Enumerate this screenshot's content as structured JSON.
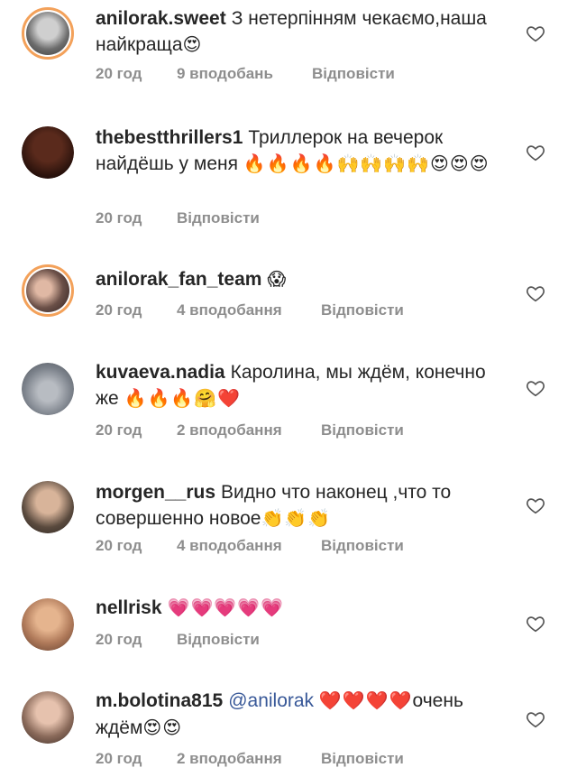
{
  "comments": [
    {
      "username": "anilorak.sweet",
      "text": "З нетерпінням чекаємо,наша найкраща",
      "emoji": "😍",
      "time": "20 год",
      "likes": "9 вподобань",
      "reply": "Відповісти",
      "avatar_color": "#7a7a7a",
      "ring": true
    },
    {
      "username": "thebestthrillers1",
      "text": "Триллерок на вечерок найдёшь у меня",
      "emoji": "🔥🔥🔥🔥🙌🙌🙌🙌😍😍😍",
      "time": "20 год",
      "likes": "",
      "reply": "Відповісти",
      "avatar_color": "#2b1a14",
      "ring": false
    },
    {
      "username": "anilorak_fan_team",
      "text": "",
      "emoji": "😱",
      "time": "20 год",
      "likes": "4 вподобання",
      "reply": "Відповісти",
      "avatar_color": "#6b5048",
      "ring": true
    },
    {
      "username": "kuvaeva.nadia",
      "text": "Каролина, мы ждём, конечно же",
      "emoji": "🔥🔥🔥🤗❤️",
      "time": "20 год",
      "likes": "2 вподобання",
      "reply": "Відповісти",
      "avatar_color": "#8a9099",
      "ring": false
    },
    {
      "username": "morgen__rus",
      "text": "Видно что наконец ,что то совершенно новое",
      "emoji": "👏👏👏",
      "time": "20 год",
      "likes": "4 вподобання",
      "reply": "Відповісти",
      "avatar_color": "#5a4a3e",
      "ring": false
    },
    {
      "username": "nellrisk",
      "text": "",
      "emoji": "💗💗💗💗💗",
      "time": "20 год",
      "likes": "",
      "reply": "Відповісти",
      "avatar_color": "#b07a5a",
      "ring": false
    },
    {
      "username": "m.bolotina815",
      "mention": "@anilorak",
      "text": "очень ждём",
      "emoji_before": "❤️❤️❤️❤️",
      "emoji": "😍😍",
      "time": "20 год",
      "likes": "2 вподобання",
      "reply": "Відповісти",
      "avatar_color": "#8a6a5a",
      "ring": false
    }
  ]
}
